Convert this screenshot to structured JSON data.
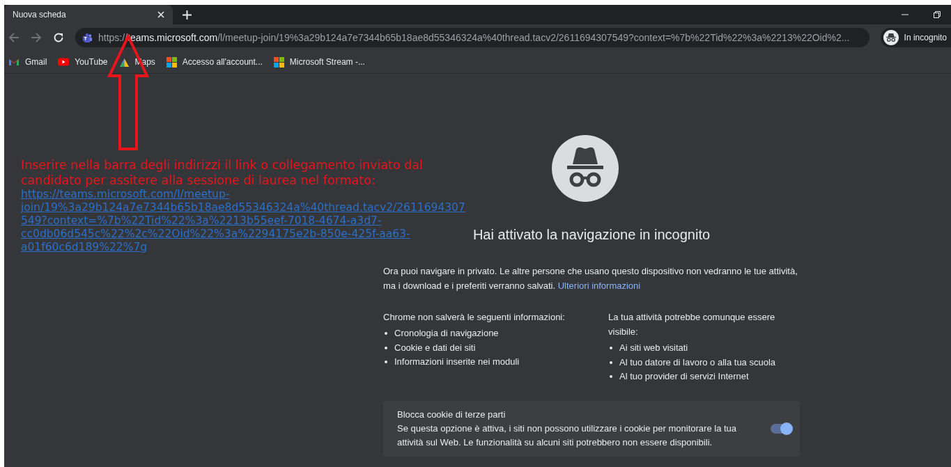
{
  "tabs": [
    {
      "title": "Nuova scheda",
      "selected": true
    }
  ],
  "toolbar": {
    "url_scheme": "https://",
    "url_host": "teams.microsoft.com",
    "url_rest": "/l/meetup-join/19%3a29b124a7e7344b65b18ae8d55346324a%40thread.tacv2/2611694307549?context=%7b%22Tid%22%3a%2213%22Oid%2...",
    "profile_label": "In incognito"
  },
  "bookmarks": [
    {
      "label": "Gmail",
      "kind": "gmail"
    },
    {
      "label": "YouTube",
      "kind": "youtube"
    },
    {
      "label": "Maps",
      "kind": "maps"
    },
    {
      "label": "Accesso all'account...",
      "kind": "windows"
    },
    {
      "label": "Microsoft Stream -...",
      "kind": "windows"
    }
  ],
  "annotation": {
    "text": "Inserire nella barra degli indirizzi il link o collegamento inviato dal candidato per assitere alla sessione di laurea nel formato:",
    "link": "https://teams.microsoft.com/l/meetup-join/19%3a29b124a7e7344b65b18ae8d55346324a%40thread.tacv2/2611694307549?context=%7b%22Tid%22%3a%2213b55eef-7018-4674-a3d7-cc0db06d545c%22%2c%22Oid%22%3a%2294175e2b-850e-425f-aa63-a01f60c6d189%22%7g"
  },
  "incognito": {
    "title": "Hai attivato la navigazione in incognito",
    "intro": "Ora puoi navigare in privato. Le altre persone che usano questo dispositivo non vedranno le tue attività, ma i download e i preferiti verranno salvati.",
    "intro_link": "Ulteriori informazioni",
    "columns": [
      {
        "heading": "Chrome non salverà le seguenti informazioni:",
        "items": [
          "Cronologia di navigazione",
          "Cookie e dati dei siti",
          "Informazioni inserite nei moduli"
        ]
      },
      {
        "heading": "La tua attività potrebbe comunque essere visibile:",
        "items": [
          "Ai siti web visitati",
          "Al tuo datore di lavoro o alla tua scuola",
          "Al tuo provider di servizi Internet"
        ]
      }
    ],
    "cookie_card": {
      "title": "Blocca cookie di terze parti",
      "text": "Se questa opzione è attiva, i siti non possono utilizzare i cookie per monitorare la tua attività sul Web. Le funzionalità su alcuni siti potrebbero non essere disponibili.",
      "on": true
    }
  }
}
